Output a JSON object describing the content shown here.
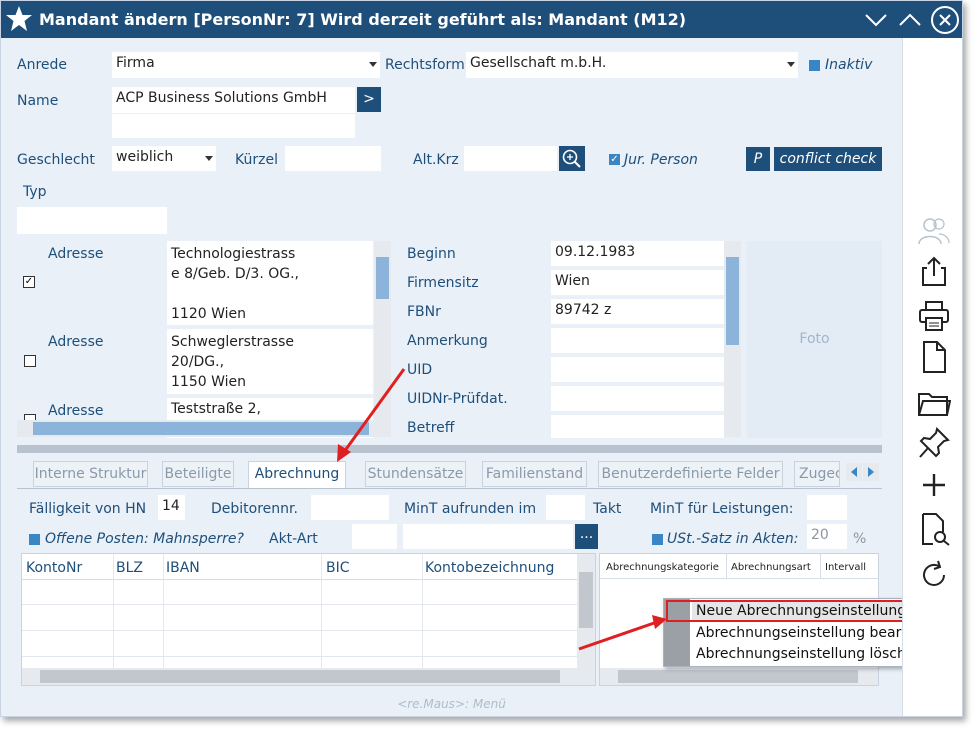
{
  "title": "Mandant ändern  [PersonNr: 7] Wird derzeit geführt als: Mandant (M12)",
  "colors": {
    "titlebar": "#1e4f7a",
    "accent": "#3a86c4",
    "label": "#1e4f7a",
    "annotation": "#e02020"
  },
  "form": {
    "anrede_label": "Anrede",
    "anrede_value": "Firma",
    "rechtsform_label": "Rechtsform",
    "rechtsform_value": "Gesellschaft m.b.H.",
    "inaktiv_label": "Inaktiv",
    "name_label": "Name",
    "name_value": "ACP Business Solutions GmbH",
    "name_btn": ">",
    "geschlecht_label": "Geschlecht",
    "geschlecht_value": "weiblich",
    "kuerzel_label": "Kürzel",
    "altkrz_label": "Alt.Krz",
    "jur_person_label": "Jur. Person",
    "p_btn": "P",
    "conflict_btn": "conflict check",
    "typ_label": "Typ"
  },
  "addresses": [
    {
      "label": "Adresse",
      "checked": true,
      "text": "Technologiestrass\ne 8/Geb. D/3. OG.,\n\n1120 Wien"
    },
    {
      "label": "Adresse",
      "checked": false,
      "text": "Schweglerstrasse\n20/DG.,\n1150 Wien"
    },
    {
      "label": "Adresse",
      "checked": false,
      "text": "Teststraße 2,"
    }
  ],
  "details": [
    {
      "label": "Beginn",
      "value": "09.12.1983"
    },
    {
      "label": "Firmensitz",
      "value": "Wien"
    },
    {
      "label": "FBNr",
      "value": "89742 z"
    },
    {
      "label": "Anmerkung",
      "value": ""
    },
    {
      "label": "UID",
      "value": ""
    },
    {
      "label": "UIDNr-Prüfdat.",
      "value": ""
    },
    {
      "label": "Betreff",
      "value": ""
    }
  ],
  "foto_label": "Foto",
  "tabs": [
    "Interne Struktur",
    "Beteiligte",
    "Abrechnung",
    "Stundensätze",
    "Familienstand",
    "Benutzerdefinierte Felder",
    "Zugec"
  ],
  "billing": {
    "faelligkeit_label": "Fälligkeit von HN",
    "faelligkeit_value": "14",
    "debitoren_label": "Debitorennr.",
    "mint_aufrunden_label": "MinT aufrunden im",
    "takt_label": "Takt",
    "mint_leistungen_label": "MinT für Leistungen:",
    "offene_posten_label": "Offene Posten: Mahnsperre?",
    "aktart_label": "Akt-Art",
    "dots_btn": "...",
    "ust_label": "USt.-Satz in Akten:",
    "ust_value": "20",
    "ust_unit": "%"
  },
  "bank_table": {
    "headers": [
      "KontoNr",
      "BLZ",
      "IBAN",
      "BIC",
      "Kontobezeichnung"
    ]
  },
  "abr_table": {
    "headers": [
      "Abrechnungskategorie",
      "Abrechnungsart",
      "Intervall"
    ]
  },
  "context_menu": [
    "Neue Abrechnungseinstellung",
    "Abrechnungseinstellung bearbeiten",
    "Abrechnungseinstellung löschen"
  ],
  "footer": "<re.Maus>: Menü"
}
